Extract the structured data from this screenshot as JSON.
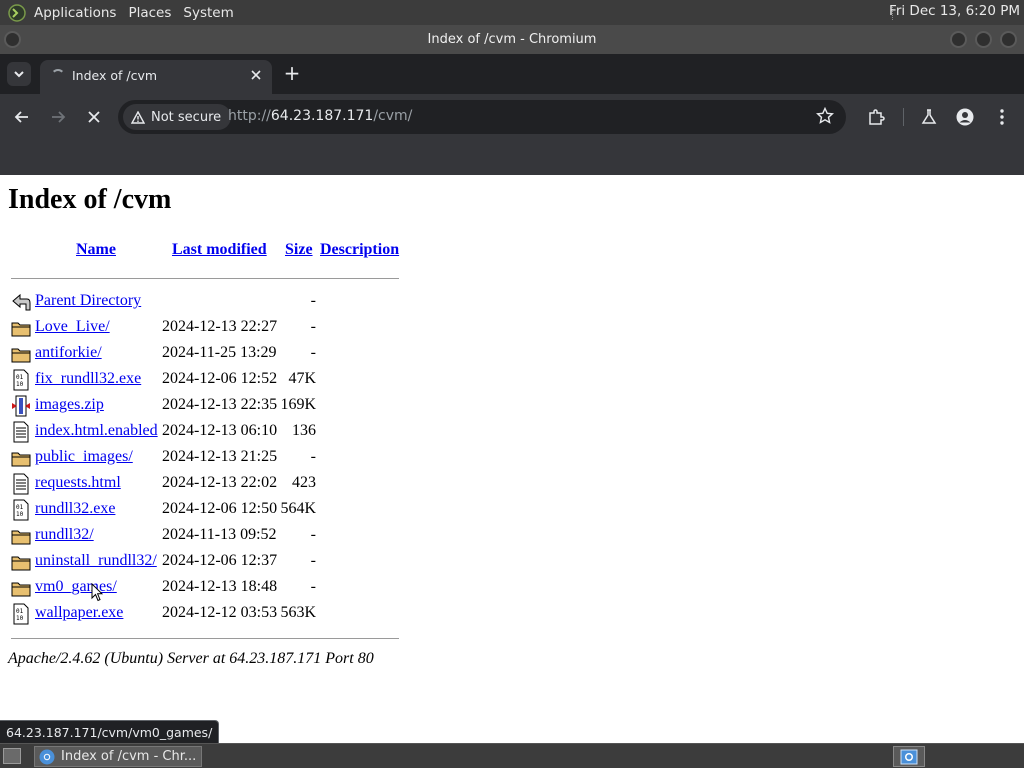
{
  "top_panel": {
    "menus": [
      "Applications",
      "Places",
      "System"
    ],
    "clock": "Fri Dec 13,  6:20 PM"
  },
  "window": {
    "title": "Index of /cvm - Chromium"
  },
  "tab": {
    "title": "Index of /cvm",
    "new_tab_label": "+"
  },
  "omnibox": {
    "security_label": "Not secure",
    "url_scheme": "http://",
    "url_host": "64.23.187.171",
    "url_path": "/cvm/"
  },
  "page": {
    "heading": "Index of /cvm",
    "columns": {
      "name": "Name",
      "last_modified": "Last modified",
      "size": "Size",
      "description": "Description"
    },
    "rows": [
      {
        "name": "Parent Directory",
        "date": "",
        "size": "-",
        "icon": "back-icon"
      },
      {
        "name": "Love_Live/",
        "date": "2024-12-13 22:27",
        "size": "-",
        "icon": "folder-icon"
      },
      {
        "name": "antiforkie/",
        "date": "2024-11-25 13:29",
        "size": "-",
        "icon": "folder-icon"
      },
      {
        "name": "fix_rundll32.exe",
        "date": "2024-12-06 12:52",
        "size": "47K",
        "icon": "binary-icon"
      },
      {
        "name": "images.zip",
        "date": "2024-12-13 22:35",
        "size": "169K",
        "icon": "archive-icon"
      },
      {
        "name": "index.html.enabled",
        "date": "2024-12-13 06:10",
        "size": "136",
        "icon": "text-file-icon"
      },
      {
        "name": "public_images/",
        "date": "2024-12-13 21:25",
        "size": "-",
        "icon": "folder-icon"
      },
      {
        "name": "requests.html",
        "date": "2024-12-13 22:02",
        "size": "423",
        "icon": "text-file-icon"
      },
      {
        "name": "rundll32.exe",
        "date": "2024-12-06 12:50",
        "size": "564K",
        "icon": "binary-icon"
      },
      {
        "name": "rundll32/",
        "date": "2024-11-13 09:52",
        "size": "-",
        "icon": "folder-icon"
      },
      {
        "name": "uninstall_rundll32/",
        "date": "2024-12-06 12:37",
        "size": "-",
        "icon": "folder-icon"
      },
      {
        "name": "vm0_games/",
        "date": "2024-12-13 18:48",
        "size": "-",
        "icon": "folder-icon"
      },
      {
        "name": "wallpaper.exe",
        "date": "2024-12-12 03:53",
        "size": "563K",
        "icon": "binary-icon"
      }
    ],
    "server_signature": "Apache/2.4.62 (Ubuntu) Server at 64.23.187.171 Port 80"
  },
  "status_bubble": "64.23.187.171/cvm/vm0_games/",
  "taskbar": {
    "task_label": "Index of /cvm - Chr..."
  },
  "colors": {
    "link": "#0000ee",
    "panel": "#3c3c3c",
    "chrome_dark": "#202124",
    "chrome_toolbar": "#35363a"
  }
}
